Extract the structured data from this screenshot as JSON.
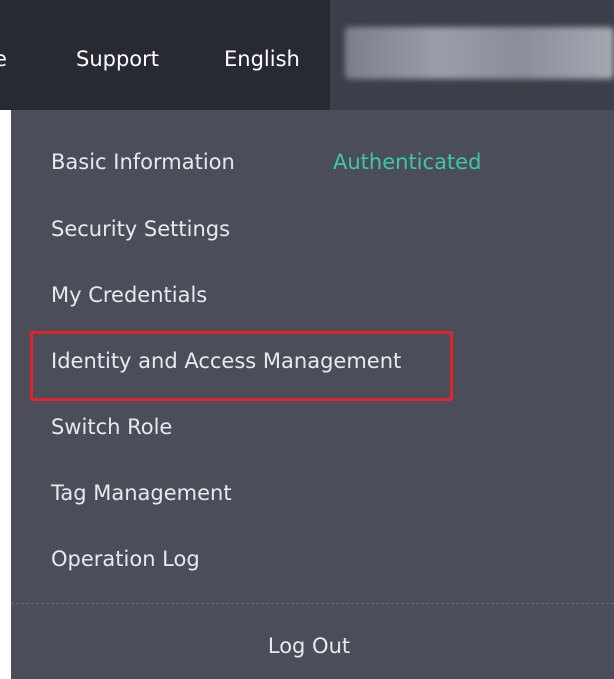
{
  "header": {
    "partial_item_label": "e",
    "support_label": "Support",
    "language_label": "English"
  },
  "menu": {
    "items": [
      {
        "label": "Basic Information",
        "status": "Authenticated"
      },
      {
        "label": "Security Settings"
      },
      {
        "label": "My Credentials"
      },
      {
        "label": "Identity and Access Management"
      },
      {
        "label": "Switch Role"
      },
      {
        "label": "Tag Management"
      },
      {
        "label": "Operation Log"
      }
    ],
    "logout_label": "Log Out"
  },
  "colors": {
    "header_dark": "#282a33",
    "header": "#3c3f49",
    "panel": "#4b4e5a",
    "status_green": "#3ec8a2",
    "highlight_red": "#e0232d"
  }
}
